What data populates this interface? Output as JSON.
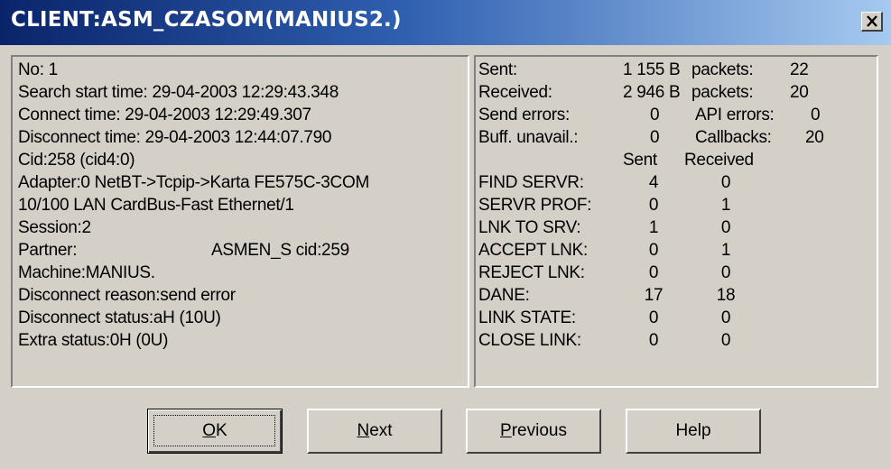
{
  "title": "CLIENT:ASM_CZASOM(MANIUS2.)",
  "close_glyph": "✕",
  "info": {
    "no": "No: 1",
    "search_start": "Search start time: 29-04-2003 12:29:43.348",
    "connect_time": "Connect time: 29-04-2003 12:29:49.307",
    "disconnect_time": "Disconnect time: 29-04-2003 12:44:07.790",
    "cid": "Cid:258 (cid4:0)",
    "adapter_1": "Adapter:0 NetBT->Tcpip->Karta FE575C-3COM",
    "adapter_2": "10/100 LAN CardBus-Fast Ethernet/1",
    "session": "Session:2",
    "partner_label": "Partner:",
    "partner_value": "ASMEN_S cid:259",
    "machine": "Machine:MANIUS.",
    "disconnect_reason": "Disconnect reason:send error",
    "disconnect_status": "Disconnect status:aH (10U)",
    "extra_status": "Extra status:0H (0U)"
  },
  "stats": {
    "sent_label": "Sent:",
    "sent_value": "1 155 B",
    "sent_packets_label": "packets:",
    "sent_packets": "22",
    "received_label": "Received:",
    "received_value": "2 946 B",
    "received_packets_label": "packets:",
    "received_packets": "20",
    "send_errors_label": "Send errors:",
    "send_errors": "0",
    "api_errors_label": "API errors:",
    "api_errors": "0",
    "buff_label": "Buff. unavail.:",
    "buff": "0",
    "callbacks_label": "Callbacks:",
    "callbacks": "20",
    "col_sent": "Sent",
    "col_received": "Received",
    "rows": [
      {
        "label": "FIND SERVR:",
        "sent": "4",
        "received": "0"
      },
      {
        "label": "SERVR PROF:",
        "sent": "0",
        "received": "1"
      },
      {
        "label": "LNK TO SRV:",
        "sent": "1",
        "received": "0"
      },
      {
        "label": "ACCEPT LNK:",
        "sent": "0",
        "received": "1"
      },
      {
        "label": "REJECT LNK:",
        "sent": "0",
        "received": "0"
      },
      {
        "label": "DANE:",
        "sent": "17",
        "received": "18"
      },
      {
        "label": "LINK STATE:",
        "sent": "0",
        "received": "0"
      },
      {
        "label": "CLOSE LINK:",
        "sent": "0",
        "received": "0"
      }
    ]
  },
  "buttons": {
    "ok_accel": "O",
    "ok_rest": "K",
    "next_accel": "N",
    "next_rest": "ext",
    "previous_accel": "P",
    "previous_rest": "revious",
    "help": "Help"
  }
}
